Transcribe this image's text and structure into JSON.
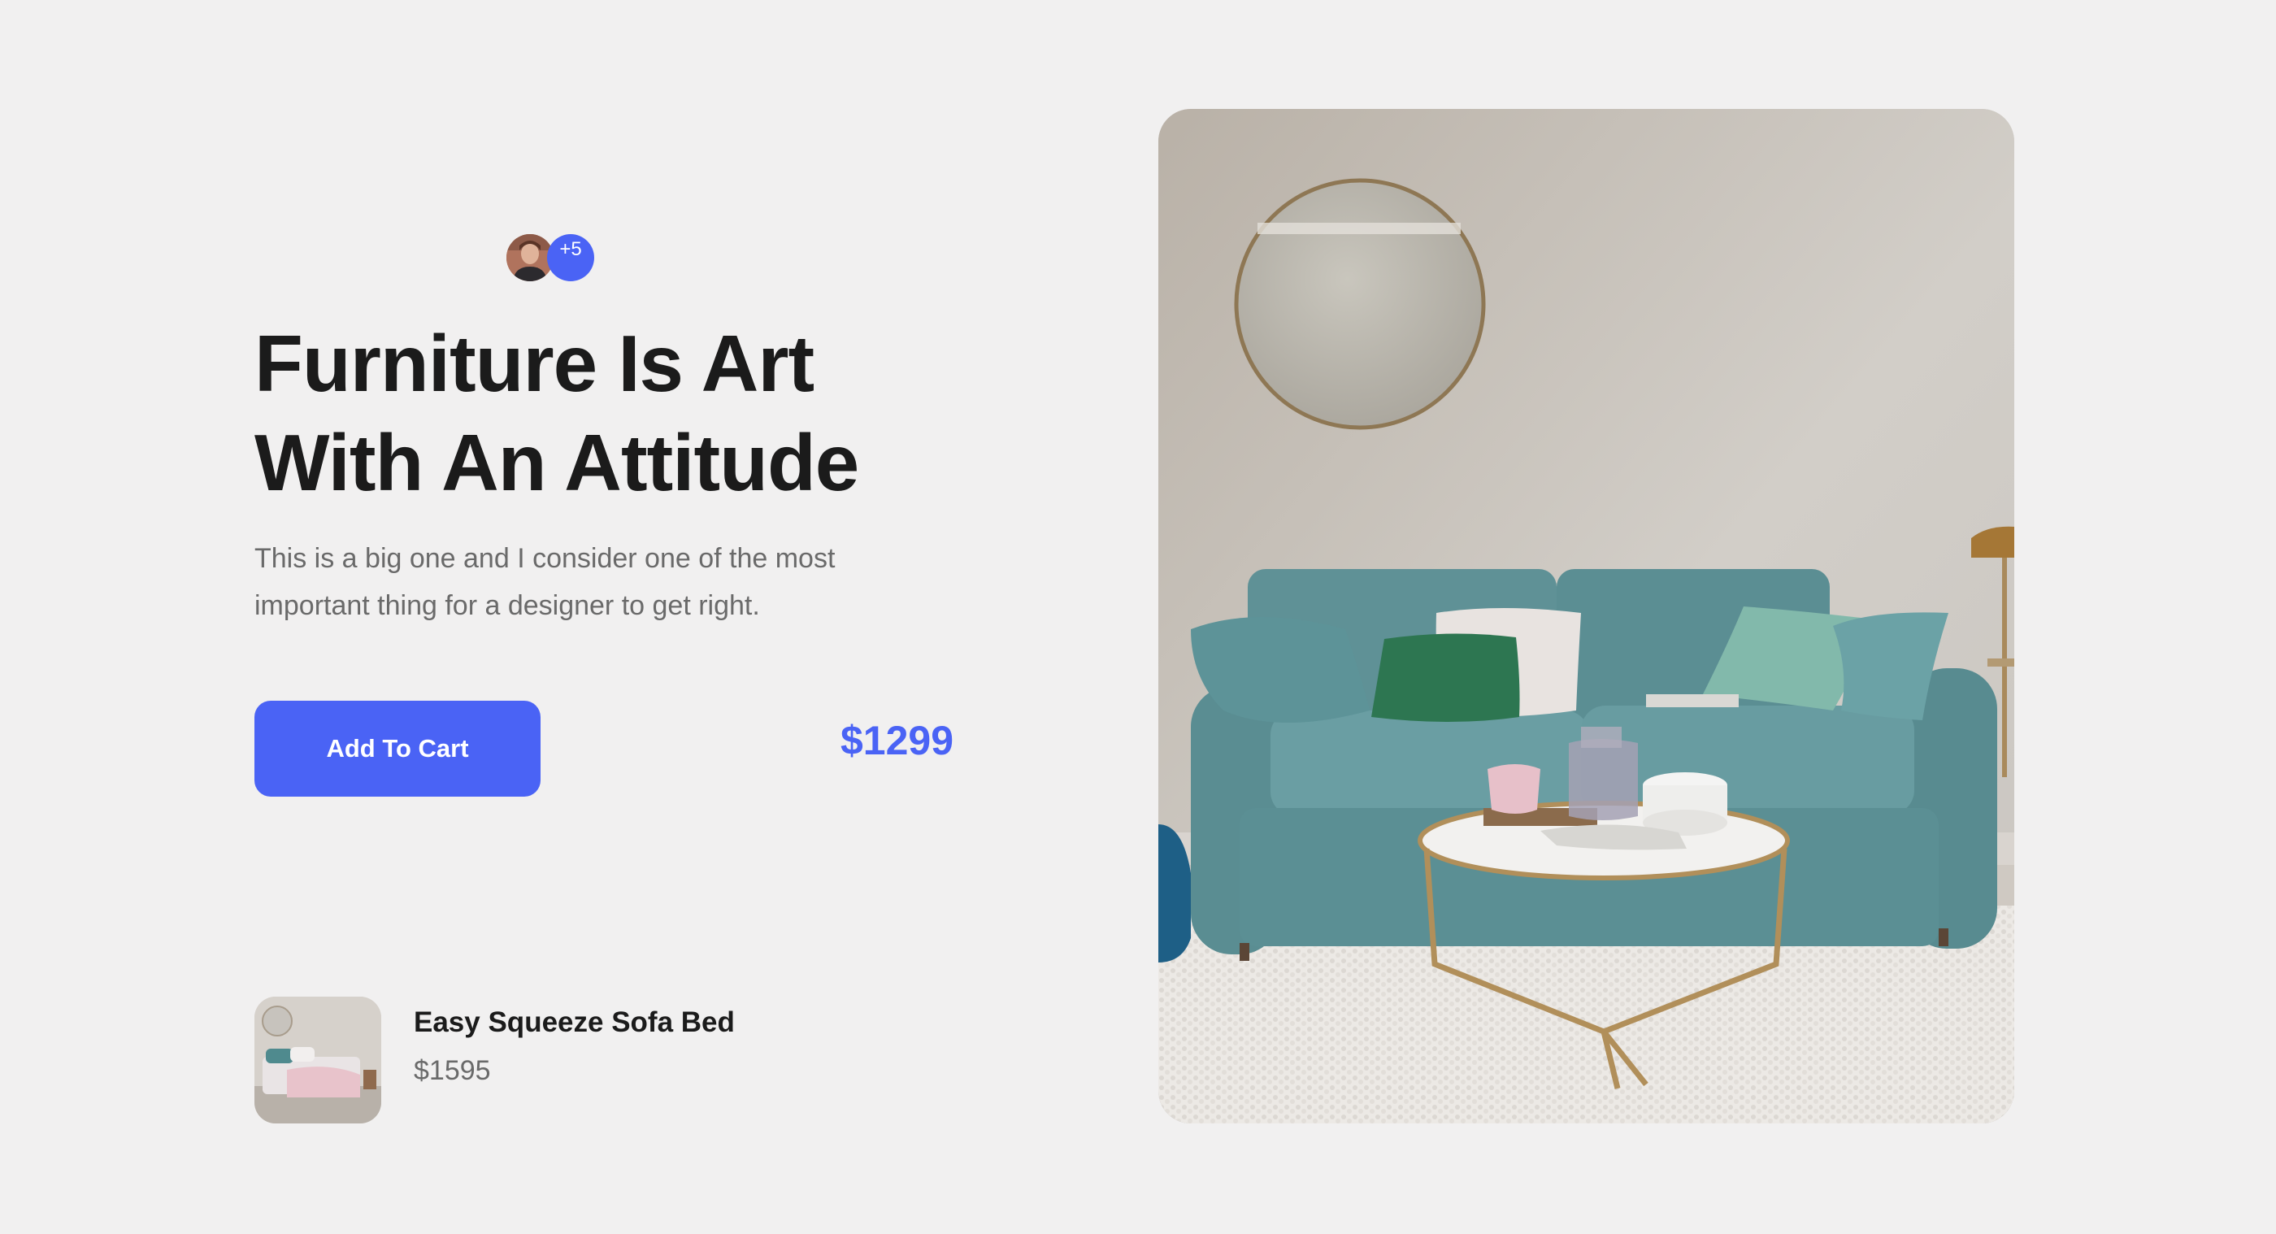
{
  "hero": {
    "avatar_extra_count": "+5",
    "headline_line1": "Furniture Is Art",
    "headline_line2": "With An Attitude",
    "description_line1": "This is a big one and I consider one of the most",
    "description_line2": "important thing for a designer to get right.",
    "cta_label": "Add To Cart",
    "price": "$1299"
  },
  "featured_product": {
    "name": "Easy Squeeze Sofa Bed",
    "price": "$1595"
  },
  "colors": {
    "accent": "#4a63f5",
    "background": "#f1f0f0",
    "text_primary": "#1b1b1b",
    "text_secondary": "#6a6a6a"
  }
}
